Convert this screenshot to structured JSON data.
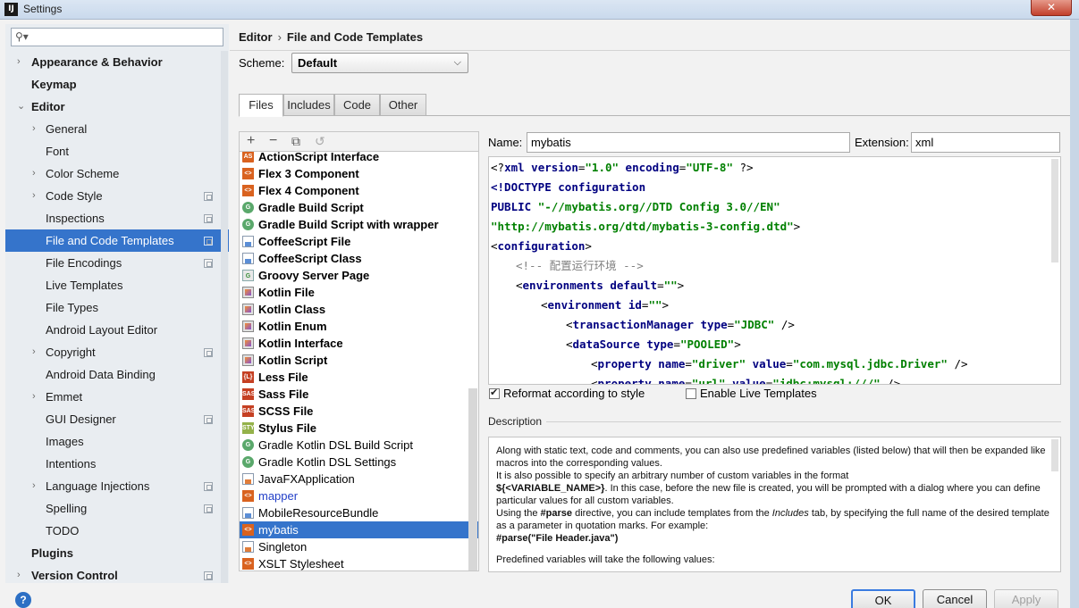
{
  "window": {
    "title": "Settings",
    "icon_text": "IJ",
    "close_symbol": "✕"
  },
  "search": {
    "placeholder": ""
  },
  "sidebar": {
    "items": [
      {
        "label": "Appearance & Behavior",
        "level": 0,
        "bold": true,
        "arrow": "›"
      },
      {
        "label": "Keymap",
        "level": 0,
        "bold": true
      },
      {
        "label": "Editor",
        "level": 0,
        "bold": true,
        "arrow": "⌄"
      },
      {
        "label": "General",
        "level": 1,
        "arrow": "›"
      },
      {
        "label": "Font",
        "level": 1
      },
      {
        "label": "Color Scheme",
        "level": 1,
        "arrow": "›"
      },
      {
        "label": "Code Style",
        "level": 1,
        "arrow": "›",
        "project": true
      },
      {
        "label": "Inspections",
        "level": 1,
        "project": true
      },
      {
        "label": "File and Code Templates",
        "level": 1,
        "project": true,
        "selected": true
      },
      {
        "label": "File Encodings",
        "level": 1,
        "project": true
      },
      {
        "label": "Live Templates",
        "level": 1
      },
      {
        "label": "File Types",
        "level": 1
      },
      {
        "label": "Android Layout Editor",
        "level": 1
      },
      {
        "label": "Copyright",
        "level": 1,
        "arrow": "›",
        "project": true
      },
      {
        "label": "Android Data Binding",
        "level": 1
      },
      {
        "label": "Emmet",
        "level": 1,
        "arrow": "›"
      },
      {
        "label": "GUI Designer",
        "level": 1,
        "project": true
      },
      {
        "label": "Images",
        "level": 1
      },
      {
        "label": "Intentions",
        "level": 1
      },
      {
        "label": "Language Injections",
        "level": 1,
        "arrow": "›",
        "project": true
      },
      {
        "label": "Spelling",
        "level": 1,
        "project": true
      },
      {
        "label": "TODO",
        "level": 1
      },
      {
        "label": "Plugins",
        "level": 0,
        "bold": true
      },
      {
        "label": "Version Control",
        "level": 0,
        "bold": true,
        "arrow": "›",
        "project": true
      }
    ]
  },
  "breadcrumb": {
    "parent": "Editor",
    "separator": "›",
    "current": "File and Code Templates"
  },
  "scheme": {
    "label": "Scheme:",
    "value": "Default"
  },
  "tabs": [
    "Files",
    "Includes",
    "Code",
    "Other"
  ],
  "toolbar": {
    "add": "+",
    "remove": "−",
    "copy": "⧉",
    "reset": "↺"
  },
  "templates": [
    {
      "label": "ActionScript Interface",
      "icon": "as",
      "icon_text": "AS",
      "bold": true
    },
    {
      "label": "Flex 3 Component",
      "icon": "flex",
      "icon_text": "<>",
      "bold": true
    },
    {
      "label": "Flex 4 Component",
      "icon": "flex",
      "icon_text": "<>",
      "bold": true
    },
    {
      "label": "Gradle Build Script",
      "icon": "gradle",
      "icon_text": "G",
      "bold": true
    },
    {
      "label": "Gradle Build Script with wrapper",
      "icon": "gradle",
      "icon_text": "G",
      "bold": true
    },
    {
      "label": "CoffeeScript File",
      "icon": "file",
      "icon_text": "",
      "bold": true
    },
    {
      "label": "CoffeeScript Class",
      "icon": "file",
      "icon_text": "",
      "bold": true
    },
    {
      "label": "Groovy Server Page",
      "icon": "groovy",
      "icon_text": "G",
      "bold": true
    },
    {
      "label": "Kotlin File",
      "icon": "kotlin",
      "icon_text": "",
      "bold": true
    },
    {
      "label": "Kotlin Class",
      "icon": "kotlin",
      "icon_text": "",
      "bold": true
    },
    {
      "label": "Kotlin Enum",
      "icon": "kotlin",
      "icon_text": "",
      "bold": true
    },
    {
      "label": "Kotlin Interface",
      "icon": "kotlin",
      "icon_text": "",
      "bold": true
    },
    {
      "label": "Kotlin Script",
      "icon": "kotlin",
      "icon_text": "",
      "bold": true
    },
    {
      "label": "Less File",
      "icon": "less",
      "icon_text": "{L}",
      "bold": true
    },
    {
      "label": "Sass File",
      "icon": "sass",
      "icon_text": "SASS",
      "bold": true
    },
    {
      "label": "SCSS File",
      "icon": "sass",
      "icon_text": "SASS",
      "bold": true
    },
    {
      "label": "Stylus File",
      "icon": "stylus",
      "icon_text": "STYL",
      "bold": true
    },
    {
      "label": "Gradle Kotlin DSL Build Script",
      "icon": "gradle",
      "icon_text": "G"
    },
    {
      "label": "Gradle Kotlin DSL Settings",
      "icon": "gradle",
      "icon_text": "G"
    },
    {
      "label": "JavaFXApplication",
      "icon": "java",
      "icon_text": ""
    },
    {
      "label": "mapper",
      "icon": "xml",
      "icon_text": "<>",
      "blue": true
    },
    {
      "label": "MobileResourceBundle",
      "icon": "file",
      "icon_text": ""
    },
    {
      "label": "mybatis",
      "icon": "xml",
      "icon_text": "<>",
      "selected": true
    },
    {
      "label": "Singleton",
      "icon": "java",
      "icon_text": ""
    },
    {
      "label": "XSLT Stylesheet",
      "icon": "xml",
      "icon_text": "<>"
    }
  ],
  "name": {
    "label": "Name:",
    "value": "mybatis"
  },
  "extension": {
    "label": "Extension:",
    "value": "xml"
  },
  "code_lines": [
    {
      "indent": 0,
      "parts": [
        [
          "p",
          "<?"
        ],
        [
          "k",
          "xml "
        ],
        [
          "k",
          "version"
        ],
        [
          "p",
          "="
        ],
        [
          "s",
          "\"1.0\" "
        ],
        [
          "k",
          "encoding"
        ],
        [
          "p",
          "="
        ],
        [
          "s",
          "\"UTF-8\" "
        ],
        [
          "p",
          "?>"
        ]
      ]
    },
    {
      "indent": 0,
      "parts": [
        [
          "k",
          "<!DOCTYPE "
        ],
        [
          "k",
          "configuration"
        ]
      ]
    },
    {
      "indent": 0,
      "parts": [
        [
          "k",
          "PUBLIC "
        ],
        [
          "s",
          "\"-//mybatis.org//DTD Config 3.0//EN\""
        ]
      ]
    },
    {
      "indent": 0,
      "parts": [
        [
          "s",
          "\"http://mybatis.org/dtd/mybatis-3-config.dtd\""
        ],
        [
          "p",
          ">"
        ]
      ]
    },
    {
      "indent": 0,
      "parts": [
        [
          "p",
          "<"
        ],
        [
          "k",
          "configuration"
        ],
        [
          "p",
          ">"
        ]
      ]
    },
    {
      "indent": 1,
      "parts": [
        [
          "cm",
          "<!-- 配置运行环境 -->"
        ]
      ]
    },
    {
      "indent": 1,
      "parts": [
        [
          "p",
          "<"
        ],
        [
          "k",
          "environments "
        ],
        [
          "k",
          "default"
        ],
        [
          "p",
          "="
        ],
        [
          "s",
          "\"\""
        ],
        [
          "p",
          ">"
        ]
      ]
    },
    {
      "indent": 2,
      "parts": [
        [
          "p",
          "<"
        ],
        [
          "k",
          "environment "
        ],
        [
          "k",
          "id"
        ],
        [
          "p",
          "="
        ],
        [
          "s",
          "\"\""
        ],
        [
          "p",
          ">"
        ]
      ]
    },
    {
      "indent": 3,
      "parts": [
        [
          "p",
          "<"
        ],
        [
          "k",
          "transactionManager "
        ],
        [
          "k",
          "type"
        ],
        [
          "p",
          "="
        ],
        [
          "s",
          "\"JDBC\" "
        ],
        [
          "p",
          "/>"
        ]
      ]
    },
    {
      "indent": 3,
      "parts": [
        [
          "p",
          "<"
        ],
        [
          "k",
          "dataSource "
        ],
        [
          "k",
          "type"
        ],
        [
          "p",
          "="
        ],
        [
          "s",
          "\"POOLED\""
        ],
        [
          "p",
          ">"
        ]
      ]
    },
    {
      "indent": 4,
      "parts": [
        [
          "p",
          "<"
        ],
        [
          "k",
          "property "
        ],
        [
          "k",
          "name"
        ],
        [
          "p",
          "="
        ],
        [
          "s",
          "\"driver\" "
        ],
        [
          "k",
          "value"
        ],
        [
          "p",
          "="
        ],
        [
          "s",
          "\"com.mysql.jdbc.Driver\" "
        ],
        [
          "p",
          "/>"
        ]
      ]
    },
    {
      "indent": 4,
      "parts": [
        [
          "p",
          "<"
        ],
        [
          "k",
          "property "
        ],
        [
          "k",
          "name"
        ],
        [
          "p",
          "="
        ],
        [
          "s",
          "\"url\" "
        ],
        [
          "k",
          "value"
        ],
        [
          "p",
          "="
        ],
        [
          "s",
          "\"jdbc:mysql:///\" "
        ],
        [
          "p",
          "/>"
        ]
      ]
    }
  ],
  "options": {
    "reformat": "Reformat according to style",
    "reformat_checked": true,
    "live": "Enable Live Templates",
    "live_checked": false
  },
  "description": {
    "label": "Description",
    "p1": "Along with static text, code and comments, you can also use predefined variables (listed below) that will then be expanded like macros into the corresponding values.",
    "p2a": "It is also possible to specify an arbitrary number of custom variables in the format",
    "p2b": "${<VARIABLE_NAME>}",
    "p2c": ". In this case, before the new file is created, you will be prompted with a dialog where you can define particular values for all custom variables.",
    "p3a": "Using the ",
    "p3b": "#parse",
    "p3c": " directive, you can include templates from the ",
    "p3d": "Includes",
    "p3e": " tab, by specifying the full name of the desired template as a parameter in quotation marks. For example:",
    "p3f": "#parse(\"File Header.java\")",
    "p4": "Predefined variables will take the following values:"
  },
  "buttons": {
    "ok": "OK",
    "cancel": "Cancel",
    "apply": "Apply"
  },
  "help": "?"
}
